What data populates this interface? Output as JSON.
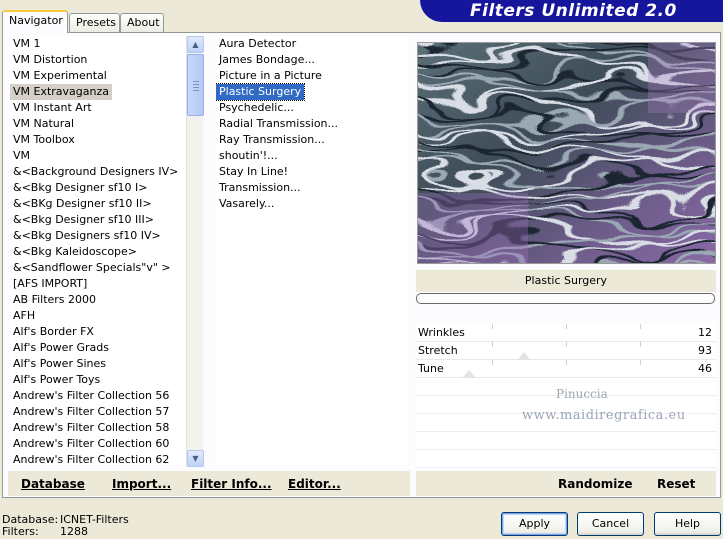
{
  "tabs": [
    {
      "label": "Navigator"
    },
    {
      "label": "Presets"
    },
    {
      "label": "About"
    }
  ],
  "title": "Filters Unlimited 2.0",
  "categories": [
    "VM 1",
    "VM Distortion",
    "VM Experimental",
    "VM Extravaganza",
    "VM Instant Art",
    "VM Natural",
    "VM Toolbox",
    "VM",
    "&<Background Designers IV>",
    "&<Bkg Designer sf10 I>",
    "&<BKg Designer sf10 II>",
    "&<Bkg Designer sf10 III>",
    "&<Bkg Designers sf10 IV>",
    "&<Bkg Kaleidoscope>",
    "&<Sandflower Specials\"v\" >",
    "[AFS IMPORT]",
    "AB Filters 2000",
    "AFH",
    "Alf's Border FX",
    "Alf's Power Grads",
    "Alf's Power Sines",
    "Alf's Power Toys",
    "Andrew's Filter Collection 56",
    "Andrew's Filter Collection 57",
    "Andrew's Filter Collection 58",
    "Andrew's Filter Collection 60",
    "Andrew's Filter Collection 62"
  ],
  "selected_category": "VM Extravaganza",
  "filters": [
    "Aura Detector",
    "James Bondage...",
    "Picture in a Picture",
    "Plastic Surgery",
    "Psychedelic...",
    "Radial Transmission...",
    "Ray Transmission...",
    "shoutin'!...",
    "Stay In Line!",
    "Transmission...",
    "Vasarely..."
  ],
  "selected_filter": "Plastic Surgery",
  "preview": {
    "filter_name": "Plastic Surgery",
    "progress": 0
  },
  "params": [
    {
      "name": "Wrinkles",
      "value": "12"
    },
    {
      "name": "Stretch",
      "value": "93"
    },
    {
      "name": "Tune",
      "value": "46"
    }
  ],
  "watermark": {
    "line1": "Pinuccia",
    "line2": "www.maidiregrafica.eu"
  },
  "toolbar": {
    "database": "Database",
    "import": "Import...",
    "filter_info": "Filter Info...",
    "editor": "Editor...",
    "randomize": "Randomize",
    "reset": "Reset"
  },
  "status": {
    "database_label": "Database:",
    "database_value": "ICNET-Filters",
    "filters_label": "Filters:",
    "filters_value": "1288"
  },
  "buttons": {
    "apply": "Apply",
    "cancel": "Cancel",
    "help": "Help"
  },
  "colors": {
    "banner": "#16169c",
    "selection": "#316ac5",
    "panel_bg": "#ece9d8"
  },
  "icons": {
    "scroll_up": "scroll-up-arrow-icon",
    "scroll_down": "scroll-down-arrow-icon"
  }
}
